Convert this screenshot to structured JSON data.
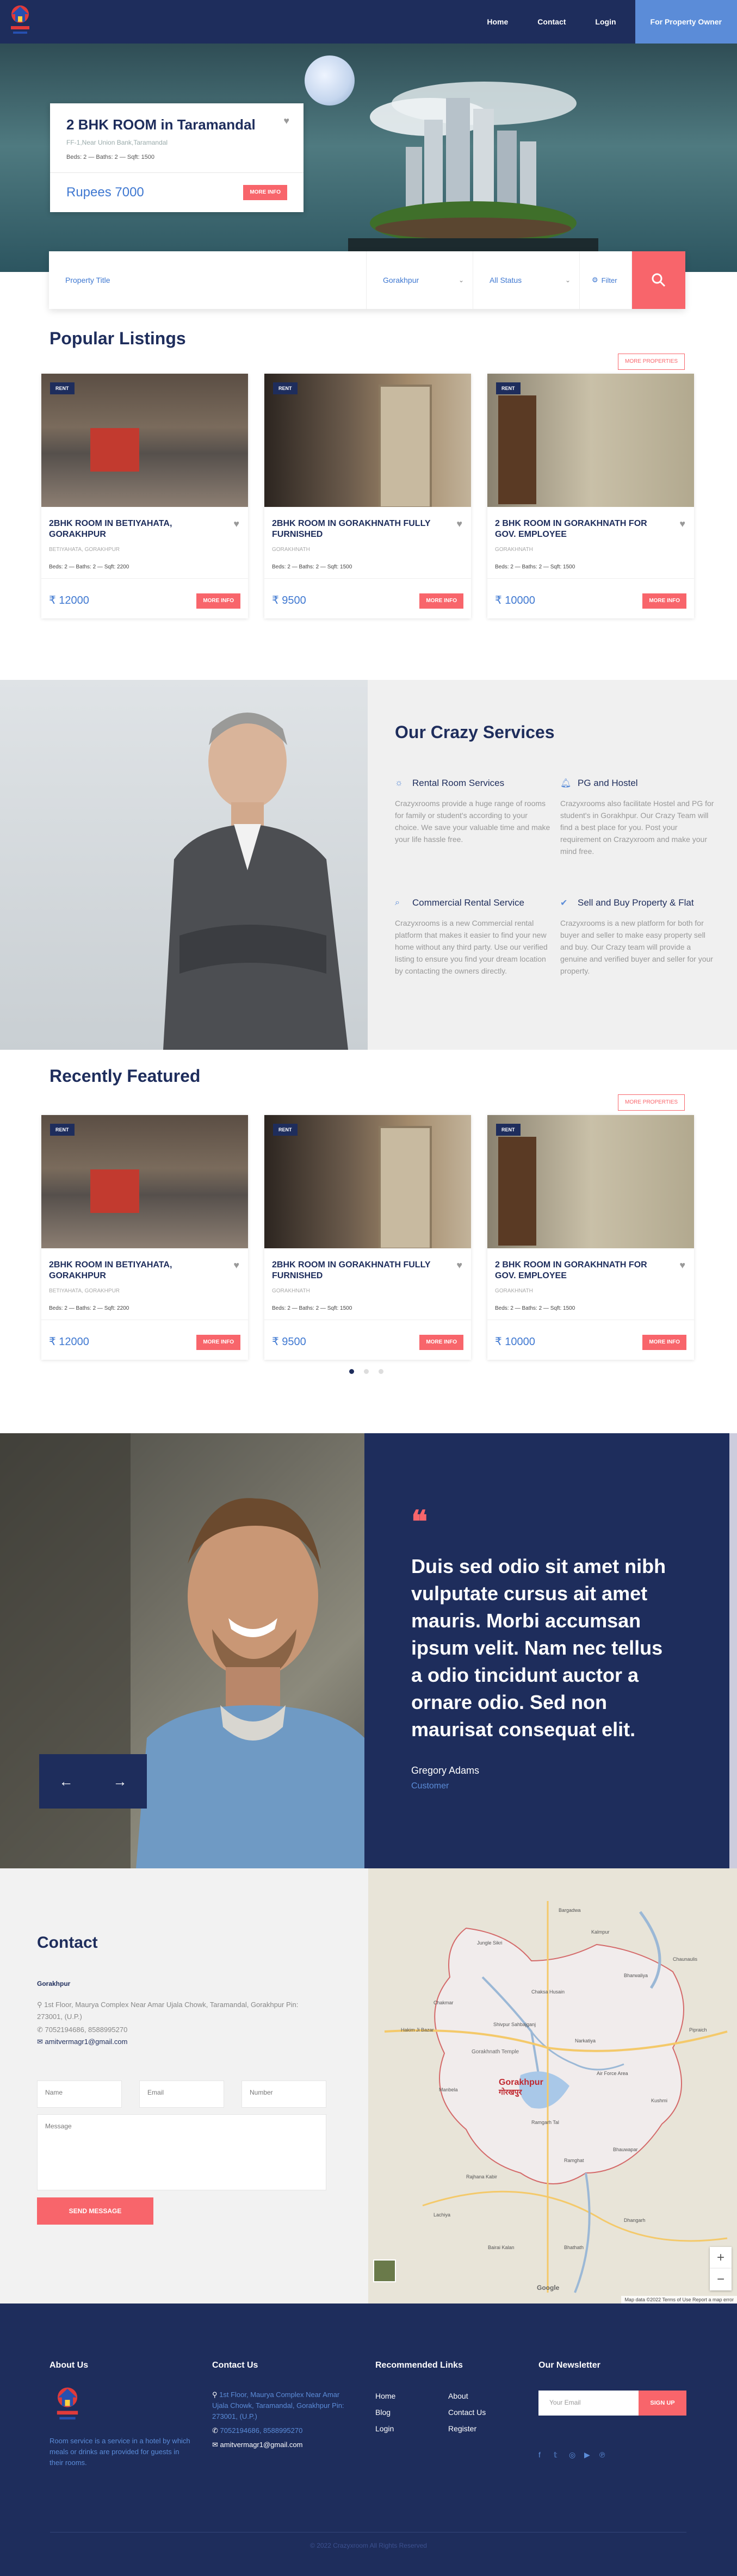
{
  "nav": {
    "links": [
      "Home",
      "Contact",
      "Login"
    ],
    "cta": "For Property Owner"
  },
  "hero": {
    "title": "2 BHK ROOM in Taramandal",
    "address": "FF-1,Near Union Bank,Taramandal",
    "meta": "Beds: 2  —  Baths: 2  —  Sqft: 1500",
    "price": "Rupees 7000",
    "more": "MORE INFO"
  },
  "search": {
    "title_placeholder": "Property Title",
    "city": "Gorakhpur",
    "status": "All Status",
    "filter": "Filter"
  },
  "popular": {
    "title": "Popular Listings",
    "more": "MORE PROPERTIES",
    "cards": [
      {
        "badge": "RENT",
        "title": "2BHK ROOM IN BETIYAHATA, GORAKHPUR",
        "addr": "BETIYAHATA, GORAKHPUR",
        "meta": "Beds: 2  —  Baths: 2  —  Sqft: 2200",
        "price": "₹ 12000",
        "more": "MORE INFO"
      },
      {
        "badge": "RENT",
        "title": "2BHK ROOM IN GORAKHNATH FULLY FURNISHED",
        "addr": "GORAKHNATH",
        "meta": "Beds: 2  —  Baths: 2  —  Sqft: 1500",
        "price": "₹ 9500",
        "more": "MORE INFO"
      },
      {
        "badge": "RENT",
        "title": "2 BHK ROOM IN GORAKHNATH FOR GOV. EMPLOYEE",
        "addr": "GORAKHNATH",
        "meta": "Beds: 2  —  Baths: 2  —  Sqft: 1500",
        "price": "₹ 10000",
        "more": "MORE INFO"
      }
    ]
  },
  "services": {
    "title": "Our Crazy Services",
    "items": [
      {
        "title": "Rental Room Services",
        "icon": "lightbulb-icon",
        "desc": "Crazyxrooms provide a huge range of rooms for family or student's according to your choice. We save your valuable time and make your life hassle free."
      },
      {
        "title": "PG and Hostel",
        "icon": "bell-icon",
        "desc": "Crazyxrooms also facilitate Hostel and PG for student's in Gorakhpur. Our Crazy Team will find a best place for you. Post your requirement on Crazyxroom and make your mind free."
      },
      {
        "title": "Commercial Rental Service",
        "icon": "search-icon",
        "desc": "Crazyxrooms is a new Commercial rental platform that makes it easier to find your new home without any third party. Use our verified listing to ensure you find your dream location by contacting the owners directly."
      },
      {
        "title": "Sell and Buy Property & Flat",
        "icon": "check-circle-icon",
        "desc": "Crazyxrooms is a new platform for both for buyer and seller to make easy property sell and buy. Our Crazy team will provide a genuine and verified buyer and seller for your property."
      }
    ]
  },
  "featured": {
    "title": "Recently Featured",
    "more": "MORE PROPERTIES",
    "cards": [
      {
        "badge": "RENT",
        "title": "2BHK ROOM IN BETIYAHATA, GORAKHPUR",
        "addr": "BETIYAHATA, GORAKHPUR",
        "meta": "Beds: 2  —  Baths: 2  —  Sqft: 2200",
        "price": "₹ 12000",
        "more": "MORE INFO"
      },
      {
        "badge": "RENT",
        "title": "2BHK ROOM IN GORAKHNATH FULLY FURNISHED",
        "addr": "GORAKHNATH",
        "meta": "Beds: 2  —  Baths: 2  —  Sqft: 1500",
        "price": "₹ 9500",
        "more": "MORE INFO"
      },
      {
        "badge": "RENT",
        "title": "2 BHK ROOM IN GORAKHNATH FOR GOV. EMPLOYEE",
        "addr": "GORAKHNATH",
        "meta": "Beds: 2  —  Baths: 2  —  Sqft: 1500",
        "price": "₹ 10000",
        "more": "MORE INFO"
      }
    ]
  },
  "testimonial": {
    "quote": "Duis sed odio sit amet nibh vulputate cursus ait amet mauris. Morbi accumsan ipsum velit. Nam nec tellus a odio tincidunt auctor a ornare odio. Sed non maurisat consequat elit.",
    "name": "Gregory Adams",
    "role": "Customer"
  },
  "contact": {
    "title": "Contact",
    "city": "Gorakhpur",
    "address": "1st Floor, Maurya Complex Near Amar Ujala Chowk, Taramandal, Gorakhpur Pin: 273001, (U.P.)",
    "phone": "7052194686, 8588995270",
    "email": "amitvermagr1@gmail.com",
    "name_ph": "Name",
    "email_ph": "Email",
    "number_ph": "Number",
    "message_ph": "Message",
    "send": "SEND MESSAGE"
  },
  "map": {
    "city_label": "Gorakhpur",
    "city_label_hi": "गोरखपुर",
    "temple_label": "Gorakhnath Temple",
    "footer": "Map data ©2022   Terms of Use   Report a map error",
    "google": "Google",
    "places": [
      "Bargadwa",
      "Jungle Sikri",
      "Kalmpur",
      "Chaksa Husain",
      "Chakmar",
      "Chaunaulis",
      "Bharwaliya",
      "Hakim Ji Bazar",
      "Shivpur Sahbajganj",
      "Ramgarh Tal",
      "Air Force Area",
      "Pipraich",
      "Bhauwapar",
      "Narkatiya",
      "Ramghat",
      "Manbela",
      "Rajhana Kabir",
      "Kushmi",
      "Lachiya",
      "Bairai Kalan",
      "Dhangarh",
      "Bhathath"
    ]
  },
  "footer": {
    "about_title": "About Us",
    "about_text": "Room service is a service in a hotel by which meals or drinks are provided for guests in their rooms.",
    "contact_title": "Contact Us",
    "contact_address": "1st Floor, Maurya Complex Near Amar Ujala Chowk, Taramandal, Gorakhpur Pin: 273001, (U.P.)",
    "contact_phone": "7052194686, 8588995270",
    "contact_email": "amitvermagr1@gmail.com",
    "links_title": "Recommended Links",
    "links_col1": [
      "Home",
      "Blog",
      "Login"
    ],
    "links_col2": [
      "About",
      "Contact Us",
      "Register"
    ],
    "news_title": "Our Newsletter",
    "email_ph": "Your Email",
    "signup": "SIGN UP",
    "copyright": "© 2022 Crazyxroom All Rights Reserved"
  },
  "colors": {
    "navy": "#1e2d5c",
    "coral": "#f8656b",
    "blue": "#3f78d1",
    "light_blue": "#5b8cd8"
  }
}
